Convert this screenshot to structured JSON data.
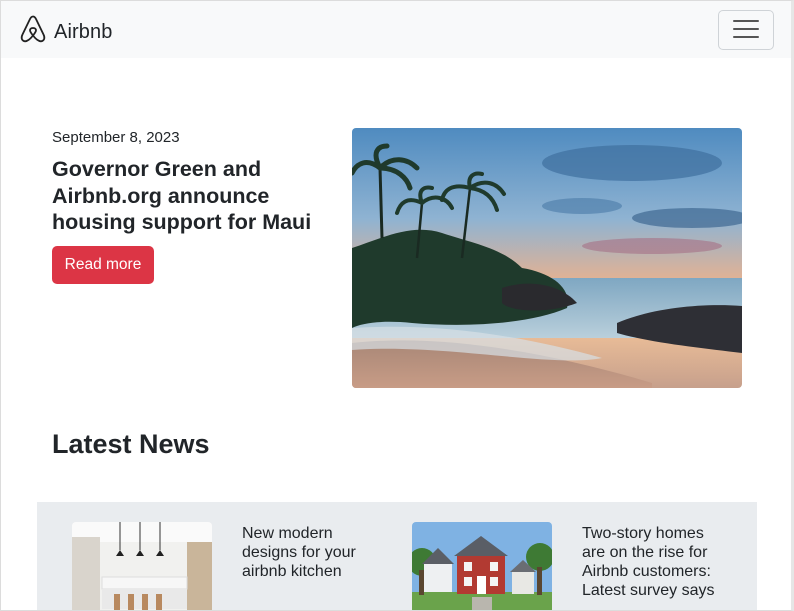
{
  "navbar": {
    "brand_name": "Airbnb"
  },
  "hero": {
    "date": "September 8, 2023",
    "title": "Governor Green and Airbnb.org announce housing support for Maui",
    "button_label": "Read more"
  },
  "latest_news": {
    "heading": "Latest News",
    "items": [
      {
        "title": "New modern designs for your airbnb kitchen"
      },
      {
        "title": "Two-story homes are on the rise for Airbnb customers: Latest survey says"
      }
    ]
  },
  "colors": {
    "navbar_bg": "#f8f9fa",
    "button_red": "#dc3545",
    "news_strip_bg": "#e9ecef"
  },
  "icons": {
    "brand": "airbnb-logo-icon",
    "menu": "hamburger-menu-icon"
  }
}
